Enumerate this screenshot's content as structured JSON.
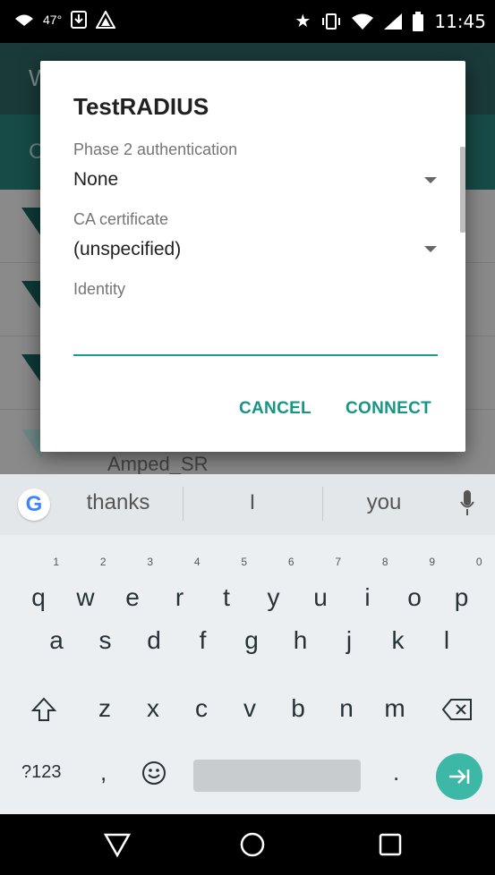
{
  "status_bar": {
    "temperature": "47°",
    "time": "11:45"
  },
  "background": {
    "toolbar_initial": "W",
    "sub_initial": "C",
    "partial_network": "Amped_SR"
  },
  "dialog": {
    "title": "TestRADIUS",
    "phase2_label": "Phase 2 authentication",
    "phase2_value": "None",
    "ca_label": "CA certificate",
    "ca_value": "(unspecified)",
    "identity_label": "Identity",
    "identity_value": "",
    "cancel_label": "CANCEL",
    "connect_label": "CONNECT"
  },
  "keyboard": {
    "suggestions": [
      "thanks",
      "I",
      "you"
    ],
    "row1": [
      {
        "k": "q",
        "h": "1"
      },
      {
        "k": "w",
        "h": "2"
      },
      {
        "k": "e",
        "h": "3"
      },
      {
        "k": "r",
        "h": "4"
      },
      {
        "k": "t",
        "h": "5"
      },
      {
        "k": "y",
        "h": "6"
      },
      {
        "k": "u",
        "h": "7"
      },
      {
        "k": "i",
        "h": "8"
      },
      {
        "k": "o",
        "h": "9"
      },
      {
        "k": "p",
        "h": "0"
      }
    ],
    "row2": [
      "a",
      "s",
      "d",
      "f",
      "g",
      "h",
      "j",
      "k",
      "l"
    ],
    "row3": [
      "z",
      "x",
      "c",
      "v",
      "b",
      "n",
      "m"
    ],
    "symbols_label": "?123",
    "comma": ",",
    "period": "."
  },
  "icons": {
    "shift": "shift-icon",
    "backspace": "backspace-icon",
    "emoji": "emoji-icon",
    "enter": "next-arrow-icon",
    "mic": "microphone-icon"
  },
  "colors": {
    "accent": "#169587",
    "enter_button": "#3db8a6"
  }
}
